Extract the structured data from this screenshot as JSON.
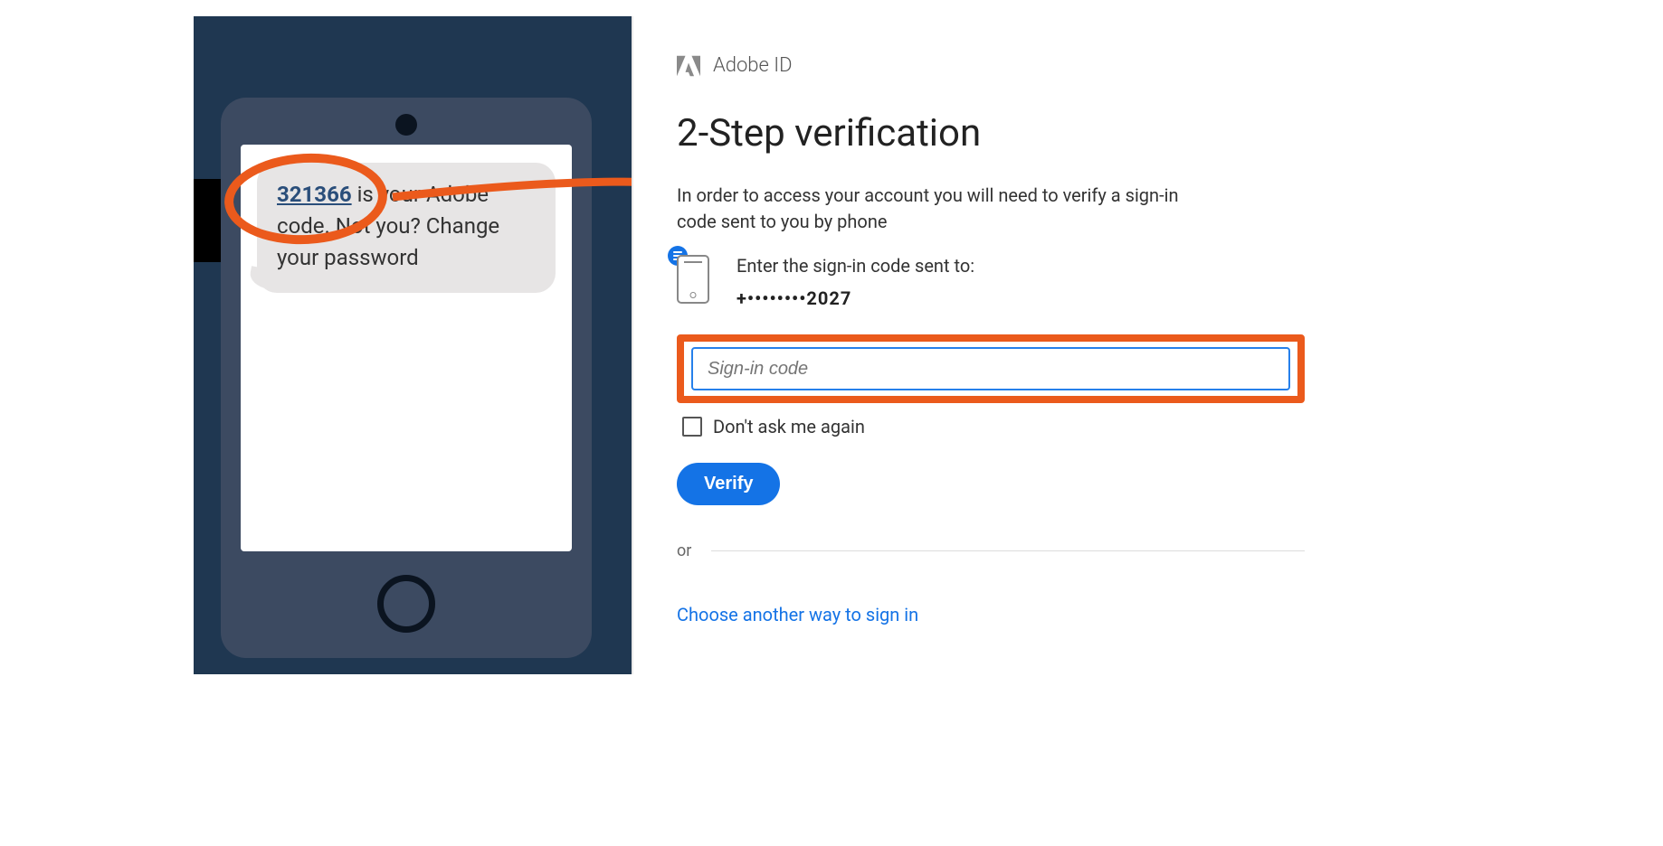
{
  "sms": {
    "code": "321366",
    "msg_before": "",
    "msg_after_code": " is your Adobe code. Not you? Change your password"
  },
  "brand": {
    "label": "Adobe ID"
  },
  "title": "2-Step verification",
  "description": "In order to access your account you will need to verify a sign-in code sent to you by phone",
  "enter_label": "Enter the sign-in code sent to:",
  "masked_phone": "+••••••••2027",
  "input": {
    "placeholder": "Sign-in code",
    "value": ""
  },
  "checkbox_label": "Don't ask me again",
  "verify_label": "Verify",
  "or_label": "or",
  "alt_link_label": "Choose another way to sign in",
  "colors": {
    "accent_orange": "#eb5a1c",
    "accent_blue": "#1473e6",
    "bg_dark": "#1f3751"
  }
}
